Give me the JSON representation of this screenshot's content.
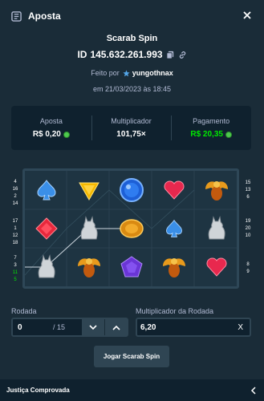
{
  "header": {
    "title": "Aposta",
    "title_icon": "bet-slip-icon",
    "close_icon": "close-icon"
  },
  "game": {
    "name": "Scarab Spin"
  },
  "bet": {
    "id_prefix": "ID",
    "id": "145.632.261.993",
    "copy_icon": "copy-icon",
    "link_icon": "link-icon"
  },
  "placed": {
    "by_label": "Feito por",
    "username": "yungothnax",
    "on_text": "em 21/03/2023 às 18:45"
  },
  "stats": [
    {
      "label": "Aposta",
      "value": "R$ 0,20",
      "coin": true,
      "color": "#ffffff"
    },
    {
      "label": "Multiplicador",
      "value": "101,75×",
      "coin": false,
      "color": "#ffffff"
    },
    {
      "label": "Pagamento",
      "value": "R$ 20,35",
      "coin": true,
      "color": "#00e701"
    }
  ],
  "board": {
    "left_numbers": [
      [
        "4",
        "16",
        "2",
        "14"
      ],
      [
        "17",
        "1",
        "12",
        "18"
      ],
      [
        "7",
        "3",
        "11",
        "5"
      ]
    ],
    "left_green": [
      "11",
      "5"
    ],
    "right_numbers": [
      [
        "15",
        "13",
        "6"
      ],
      [
        "19",
        "20",
        "10"
      ],
      [
        "8",
        "9"
      ]
    ],
    "grid": [
      [
        "spade-gem",
        "triangle-gem",
        "blue-orb",
        "heart-gem",
        "scarab"
      ],
      [
        "diamond-gem",
        "cat-statue",
        "gold-coin",
        "spade-gem",
        "cat-statue"
      ],
      [
        "cat-statue",
        "scarab",
        "pentagon-gem",
        "scarab",
        "heart-gem"
      ]
    ]
  },
  "controls": {
    "round_label": "Rodada",
    "round_value": "0",
    "round_total": "/ 15",
    "round_multiplier_label": "Multiplicador da Rodada",
    "round_multiplier_value": "6,20",
    "clear_label": "X",
    "play_button": "Jogar Scarab Spin"
  },
  "footer": {
    "label": "Justiça Comprovada"
  },
  "colors": {
    "background": "#1a2c38",
    "panel": "#0f212e",
    "border": "#2f4553",
    "muted": "#b1bad3",
    "green": "#00e701"
  }
}
